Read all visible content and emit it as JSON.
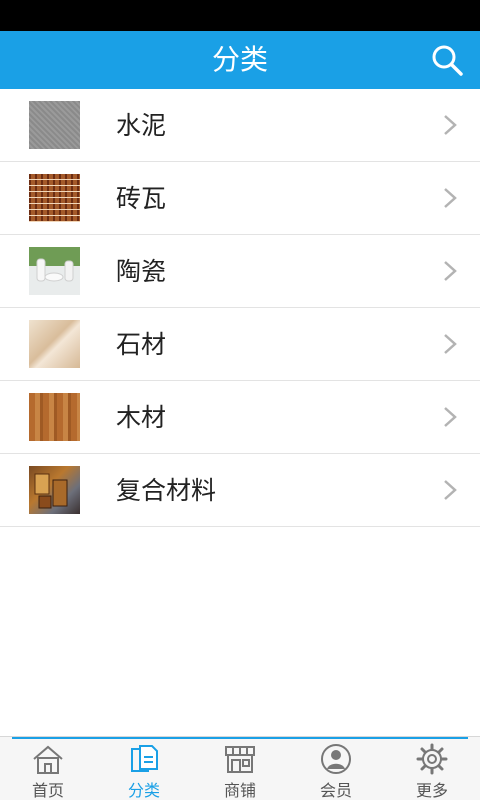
{
  "header": {
    "title": "分类",
    "search_icon": "search-icon"
  },
  "categories": [
    {
      "label": "水泥",
      "thumb": "cement-thumbnail"
    },
    {
      "label": "砖瓦",
      "thumb": "brick-tile-thumbnail"
    },
    {
      "label": "陶瓷",
      "thumb": "ceramics-thumbnail"
    },
    {
      "label": "石材",
      "thumb": "stone-thumbnail"
    },
    {
      "label": "木材",
      "thumb": "wood-thumbnail"
    },
    {
      "label": "复合材料",
      "thumb": "composite-material-thumbnail"
    }
  ],
  "tabbar": {
    "active_color": "#1aa0e6",
    "tabs": [
      {
        "label": "首页",
        "icon": "home-icon"
      },
      {
        "label": "分类",
        "icon": "category-icon",
        "active": true
      },
      {
        "label": "商铺",
        "icon": "store-icon"
      },
      {
        "label": "会员",
        "icon": "member-icon"
      },
      {
        "label": "更多",
        "icon": "gear-icon"
      }
    ]
  },
  "colors": {
    "header_bg": "#1aa0e6",
    "divider": "#e3e3e3",
    "text": "#222222"
  }
}
